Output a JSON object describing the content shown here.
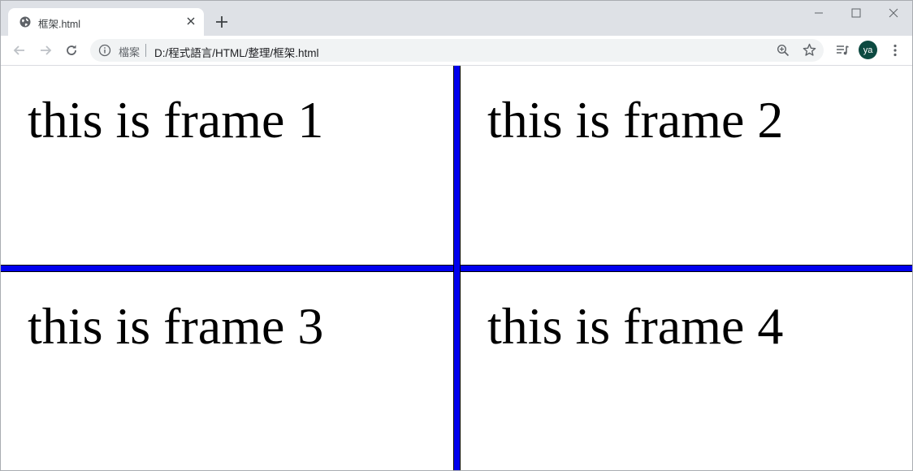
{
  "browser": {
    "tab": {
      "title": "框架.html"
    },
    "address": {
      "scheme_label": "檔案",
      "url": "D:/程式語言/HTML/整理/框架.html"
    },
    "profile": {
      "initials": "ya"
    }
  },
  "colors": {
    "frame_border": "#0000ee",
    "tabstrip": "#dee1e6",
    "avatar": "#0d4a41"
  },
  "icons": [
    "globe-icon",
    "close-icon",
    "plus-icon",
    "minimize-icon",
    "maximize-icon",
    "window-close-icon",
    "back-icon",
    "forward-icon",
    "reload-icon",
    "info-icon",
    "zoom-icon",
    "star-icon",
    "media-icon",
    "menu-icon"
  ],
  "frames": [
    {
      "text": "this is frame 1"
    },
    {
      "text": "this is frame 2"
    },
    {
      "text": "this is frame 3"
    },
    {
      "text": "this is frame 4"
    }
  ]
}
